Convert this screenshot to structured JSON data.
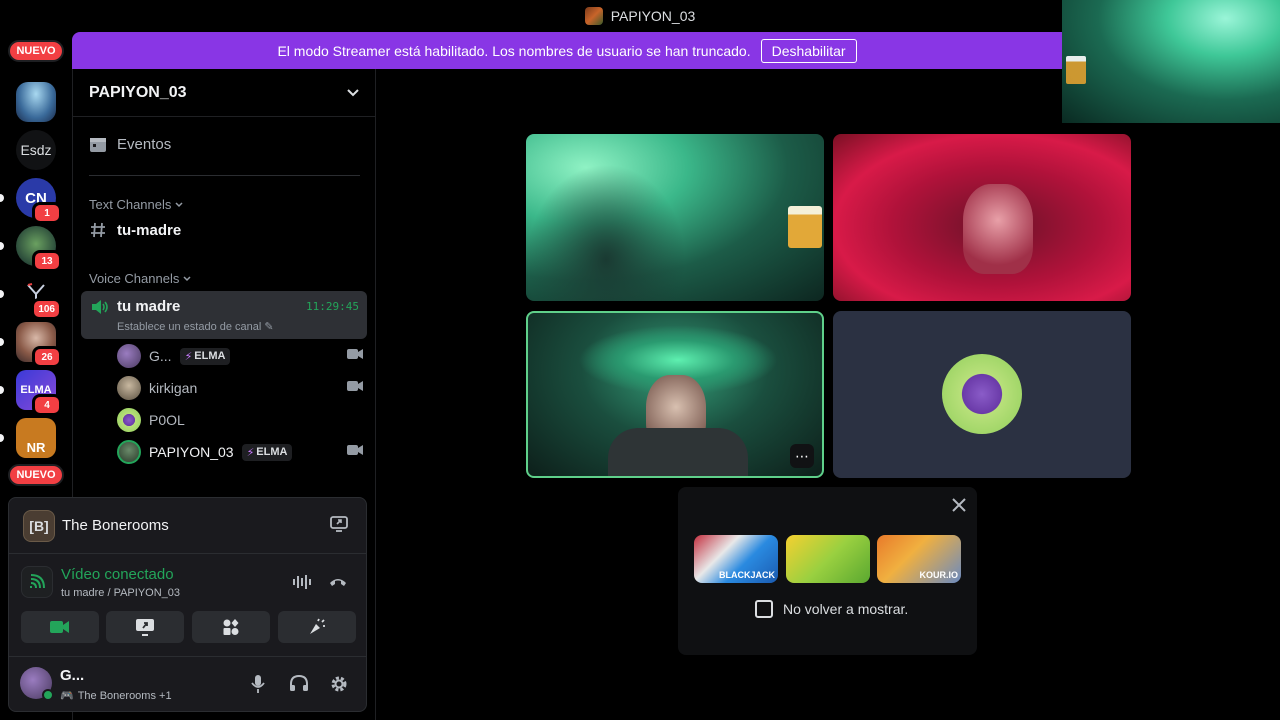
{
  "window": {
    "title": "PAPIYON_03"
  },
  "banner": {
    "message": "El modo Streamer está habilitado. Los nombres de usuario se han truncado.",
    "button": "Deshabilitar"
  },
  "rail": {
    "nuevo_top": "NUEVO",
    "esdz": "Esdz",
    "badges": [
      "1",
      "13",
      "106",
      "26",
      "4"
    ],
    "nuevo_bottom": "NUEVO",
    "cn_label": "CN",
    "elma_label": "ELMA",
    "nr_label": "NR"
  },
  "guild": {
    "name": "PAPIYON_03",
    "events": "Eventos",
    "text_category": "Text Channels",
    "text_channel": "tu-madre",
    "voice_category": "Voice Channels",
    "voice_channel": {
      "name": "tu madre",
      "status": "Establece un estado de canal",
      "time": "11:29:45"
    },
    "members": [
      {
        "name": "G...",
        "tag": "ELMA",
        "camera": true
      },
      {
        "name": "kirkigan",
        "tag": "",
        "camera": true
      },
      {
        "name": "P0OL",
        "tag": "",
        "camera": false
      },
      {
        "name": "PAPIYON_03",
        "tag": "ELMA",
        "camera": true
      }
    ]
  },
  "panel": {
    "server": "The Bonerooms",
    "server_icon": "[B]",
    "status": "Vídeo conectado",
    "location": "tu madre / PAPIYON_03",
    "user": {
      "name": "G...",
      "activity": "The Bonerooms +1"
    }
  },
  "activities": {
    "items": [
      "BLACKJACK",
      "",
      "KOUR.IO"
    ],
    "dont_show": "No volver a mostrar."
  },
  "colors": {
    "streamer_banner": "#8936e5",
    "connected_green": "#23a55a",
    "badge_red": "#f23f43",
    "active_tile_border": "#5fd08a"
  }
}
